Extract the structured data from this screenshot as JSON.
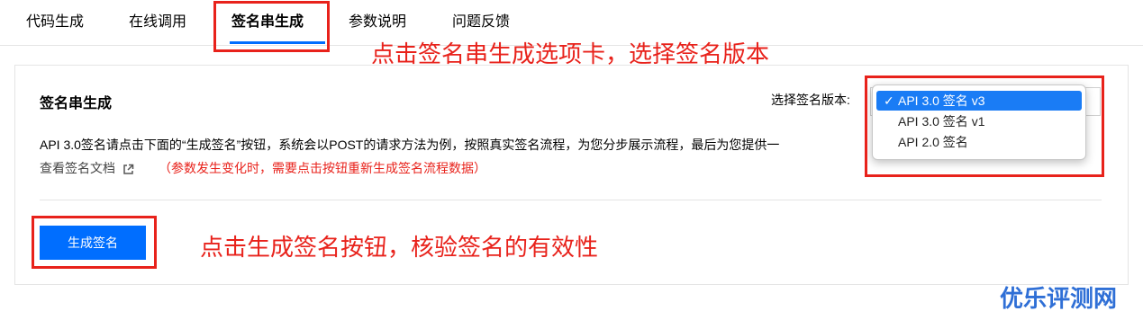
{
  "tabs": [
    {
      "label": "代码生成"
    },
    {
      "label": "在线调用"
    },
    {
      "label": "签名串生成"
    },
    {
      "label": "参数说明"
    },
    {
      "label": "问题反馈"
    }
  ],
  "section": {
    "title": "签名串生成",
    "version_label": "选择签名版本:"
  },
  "description": {
    "text": "API 3.0签名请点击下面的“生成签名”按钮，系统会以POST的请求方法为例，按照真实签名流程，为您分步展示流程，最后为您提供一",
    "tail": "。",
    "doc_link": "查看签名文档",
    "note": "（参数发生变化时，需要点击按钮重新生成签名流程数据）"
  },
  "version_dropdown": {
    "selected": "API 3.0 签名 v3",
    "options": [
      "API 3.0 签名 v3",
      "API 3.0 签名 v1",
      "API 2.0 签名"
    ],
    "check": "✓"
  },
  "button": {
    "label": "生成签名"
  },
  "annotations": {
    "tab_hint": "点击签名串生成选项卡，选择签名版本",
    "button_hint": "点击生成签名按钮，核验签名的有效性",
    "color": "#e8221b"
  },
  "watermark": "优乐评测网",
  "colors": {
    "accent": "#006eff",
    "annotation": "#e8221b",
    "watermark": "#2f6fd6"
  }
}
